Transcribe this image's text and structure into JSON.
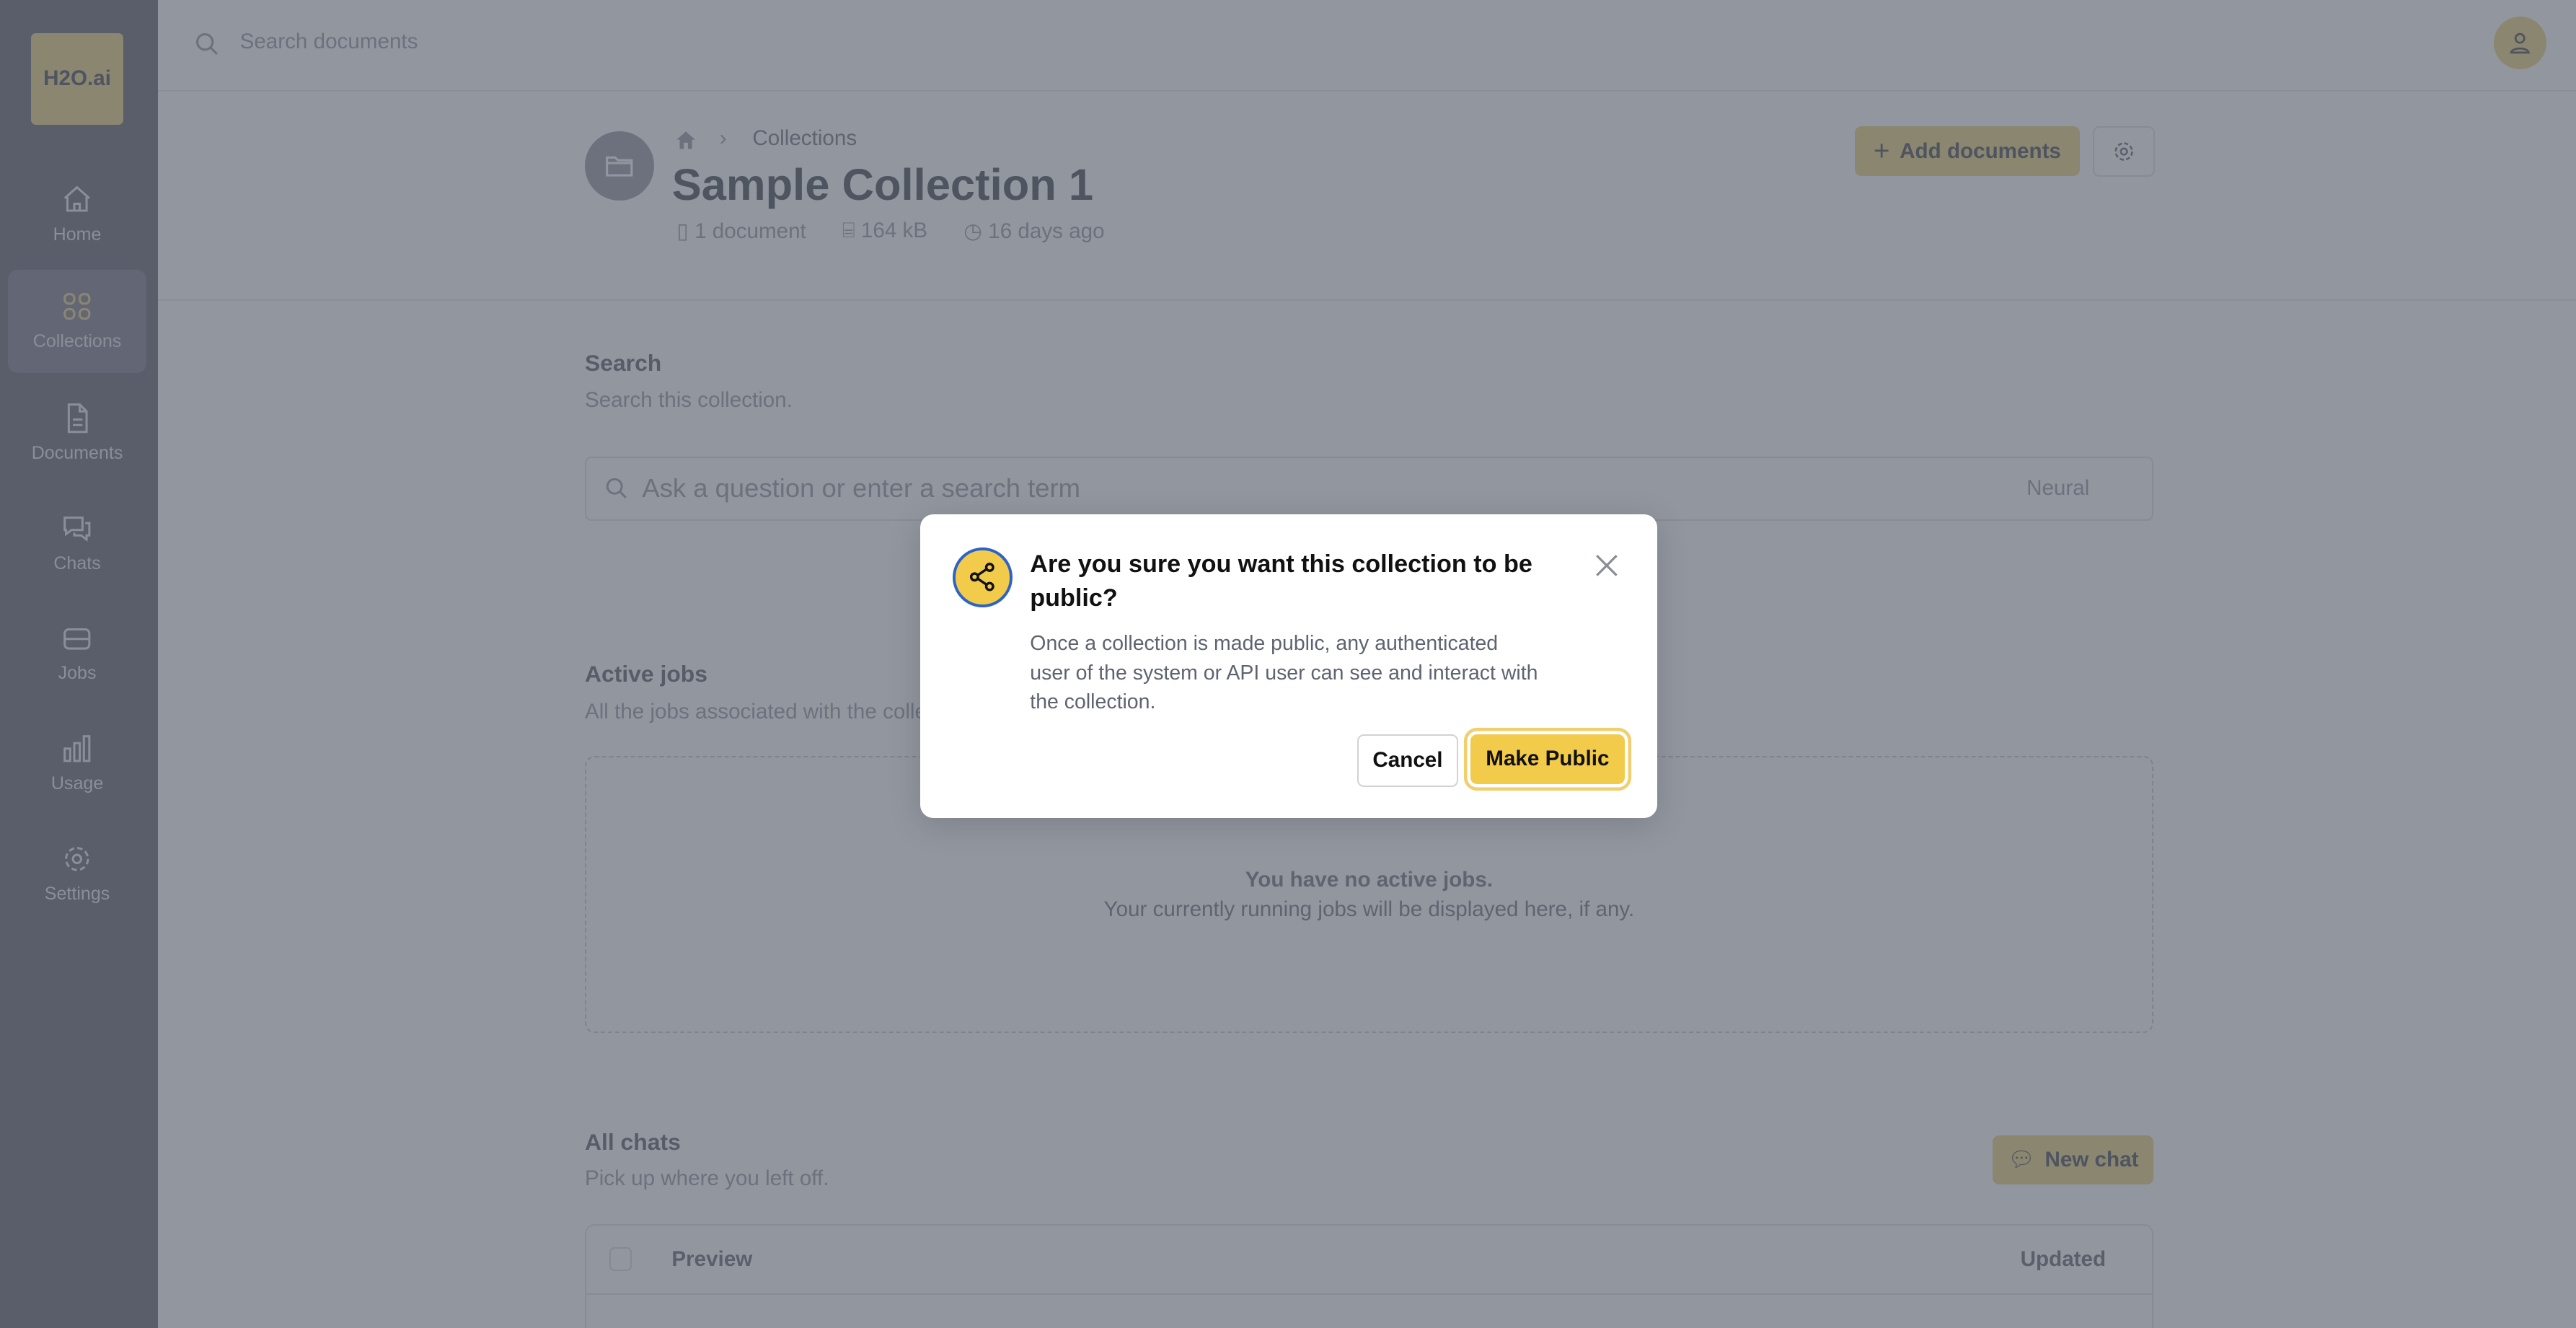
{
  "sidebar": {
    "logo": "H2O.ai",
    "items": [
      {
        "label": "Home",
        "icon": "home-icon"
      },
      {
        "label": "Collections",
        "icon": "collections-icon",
        "active": true
      },
      {
        "label": "Documents",
        "icon": "document-icon"
      },
      {
        "label": "Chats",
        "icon": "chat-icon"
      },
      {
        "label": "Jobs",
        "icon": "jobs-icon"
      },
      {
        "label": "Usage",
        "icon": "usage-icon"
      },
      {
        "label": "Settings",
        "icon": "gear-icon"
      }
    ]
  },
  "topbar": {
    "search_placeholder": "Search documents"
  },
  "header": {
    "breadcrumb": [
      "Collections"
    ],
    "title": "Sample Collection 1",
    "meta": {
      "documents": "1 document",
      "size": "164 kB",
      "updated": "16 days ago"
    },
    "add_documents": "Add documents"
  },
  "search": {
    "title": "Search",
    "subtitle": "Search this collection.",
    "placeholder": "Ask a question or enter a search term",
    "mode": "Neural"
  },
  "jobs": {
    "title": "Active jobs",
    "subtitle": "All the jobs associated with the collection.",
    "empty_title": "You have no active jobs.",
    "empty_text": "Your currently running jobs will be displayed here, if any."
  },
  "chats": {
    "title": "All chats",
    "subtitle": "Pick up where you left off.",
    "new_chat": "New chat",
    "columns": [
      "Preview",
      "Updated"
    ]
  },
  "modal": {
    "title": "Are you sure you want this collection to be public?",
    "body": "Once a collection is made public, any authenticated user of the system or API user can see and interact with the collection.",
    "cancel": "Cancel",
    "confirm": "Make Public",
    "icon": "share-icon"
  },
  "colors": {
    "accent": "#f3cb4a",
    "icon_ring": "#2b63c8"
  }
}
